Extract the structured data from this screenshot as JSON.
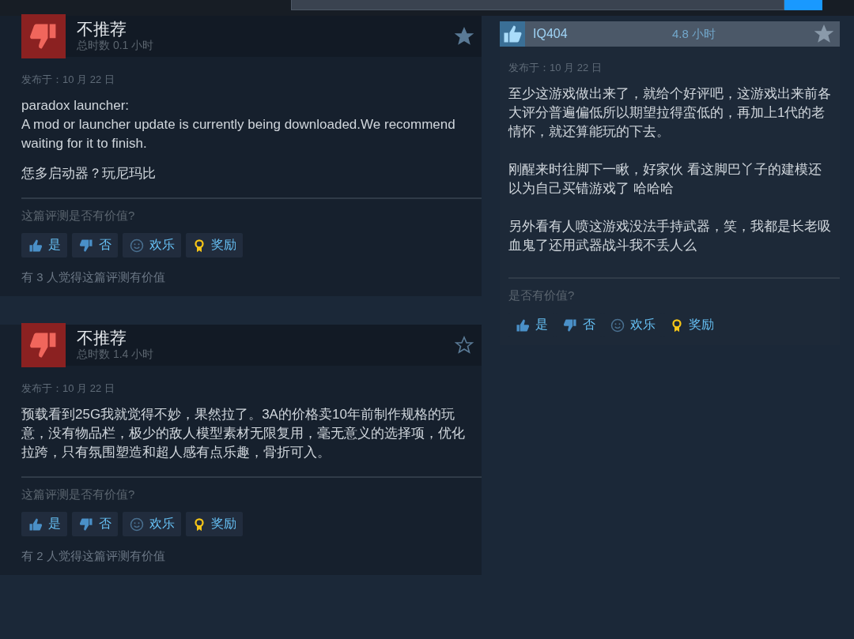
{
  "top_bar": {
    "search": {
      "has_button": true
    }
  },
  "left_reviews": [
    {
      "recommended": false,
      "title": "不推荐",
      "hours": "总时数 0.1 小时",
      "starred": true,
      "posted": "发布于：10 月 22 日",
      "paragraphs": [
        "paradox launcher:\nA mod or launcher update is currently being downloaded.We recommend waiting for it to finish.",
        "恁多启动器？玩尼玛比"
      ],
      "question": "这篇评测是否有价值?",
      "buttons": [
        {
          "kind": "yes",
          "label": "是"
        },
        {
          "kind": "no",
          "label": "否"
        },
        {
          "kind": "funny",
          "label": "欢乐"
        },
        {
          "kind": "award",
          "label": "奖励"
        }
      ],
      "helpful": "有 3 人觉得这篇评测有价值"
    },
    {
      "recommended": false,
      "title": "不推荐",
      "hours": "总时数 1.4 小时",
      "starred": false,
      "posted": "发布于：10 月 22 日",
      "paragraphs": [
        "预载看到25G我就觉得不妙，果然拉了。3A的价格卖10年前制作规格的玩意，没有物品栏，极少的敌人模型素材无限复用，毫无意义的选择项，优化拉跨，只有氛围塑造和超人感有点乐趣，骨折可入。"
      ],
      "question": "这篇评测是否有价值?",
      "buttons": [
        {
          "kind": "yes",
          "label": "是"
        },
        {
          "kind": "no",
          "label": "否"
        },
        {
          "kind": "funny",
          "label": "欢乐"
        },
        {
          "kind": "award",
          "label": "奖励"
        }
      ],
      "helpful": "有 2 人觉得这篇评测有价值"
    }
  ],
  "right_review": {
    "recommended": true,
    "user": "IQ404",
    "hours": "4.8 小时",
    "starred": true,
    "posted": "发布于：10 月 22 日",
    "paragraphs": [
      "至少这游戏做出来了，就给个好评吧，这游戏出来前各大评分普遍偏低所以期望拉得蛮低的，再加上1代的老情怀，就还算能玩的下去。",
      "刚醒来时往脚下一瞅，好家伙 看这脚巴丫子的建模还以为自己买错游戏了 哈哈哈",
      "另外看有人喷这游戏没法手持武器，笑，我都是长老吸血鬼了还用武器战斗我不丢人么"
    ],
    "question": "是否有价值?",
    "buttons": [
      {
        "kind": "yes",
        "label": "是"
      },
      {
        "kind": "no",
        "label": "否"
      },
      {
        "kind": "funny",
        "label": "欢乐"
      },
      {
        "kind": "award",
        "label": "奖励"
      }
    ]
  }
}
